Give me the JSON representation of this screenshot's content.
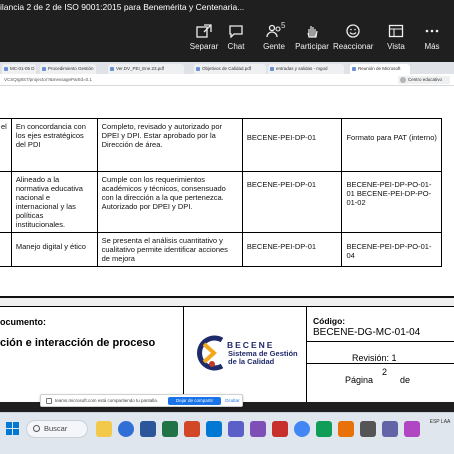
{
  "meeting": {
    "title": "ilancia 2 de 2 de ISO 9001:2015 para Benemérita y Centenaria..."
  },
  "toolbar": {
    "separar": "Separar",
    "chat": "Chat",
    "gente": "Gente",
    "gente_count": "5",
    "participar": "Participar",
    "reaccionar": "Reaccionar",
    "vista": "Vista",
    "mas": "Más"
  },
  "browser": {
    "tabs": [
      "MC-01-05 D",
      "Procedimiento Gestión",
      "Ver.DV_PEI_Ene.23.pdf",
      "Objetivos de Calidad.pdf",
      "entradas y salidas - mgod",
      "Reunión de Microsoft"
    ],
    "url": "VCSQIg8S7/projector?&messagePartId=0.1",
    "extension": "Centro educativo"
  },
  "table": {
    "rows": [
      {
        "col1": "el",
        "col2": "En concordancia con los ejes estratégicos del PDI",
        "col3": "Completo, revisado y autorizado por DPEI y DPI. Estar aprobado por la Dirección de área.",
        "col4": "BECENE-PEI-DP-01",
        "col5": "Formato para PAT (interno)"
      },
      {
        "col1": "",
        "col2": "Alineado a la normativa educativa nacional e internacional y las políticas institucionales.",
        "col3": "Cumple con los requerimientos académicos y técnicos, consensuado con la dirección a la que pertenezca. Autorizado por DPEI y DPI.",
        "col4": "BECENE-PEI-DP-01",
        "col5": "BECENE-PEI-DP-PO-01-01 BECENE-PEI-DP-PO-01-02"
      },
      {
        "col1": "",
        "col2": "Manejo digital y ético",
        "col3": "Se presenta el análisis cuantitativo y cualitativo permite identificar acciones de mejora",
        "col4": "BECENE-PEI-DP-01",
        "col5": "BECENE-PEI-DP-PO-01-04"
      }
    ]
  },
  "doc_header": {
    "doc_label": "ocumento:",
    "doc_title": "ción e interacción de proceso",
    "logo_letters": "BECENE",
    "logo_sub": "Sistema de Gestión de la Calidad",
    "codigo_label": "Código:",
    "codigo_value": "BECENE-DG-MC-01-04",
    "revision": "Revisión: 1",
    "pagina_num": "2",
    "pagina_label": "Página",
    "pagina_de": "de"
  },
  "share": {
    "message": "teams.microsoft.com está compartiendo tu pantalla.",
    "stop": "Dejar de compartir",
    "hide": "Ocultar"
  },
  "taskbar": {
    "search": "Buscar",
    "clock": "ESP LAA"
  },
  "colors": {
    "teams_bg": "#1f1f1f",
    "share_button": "#1a73e8",
    "logo_blue": "#1f2a6b"
  }
}
